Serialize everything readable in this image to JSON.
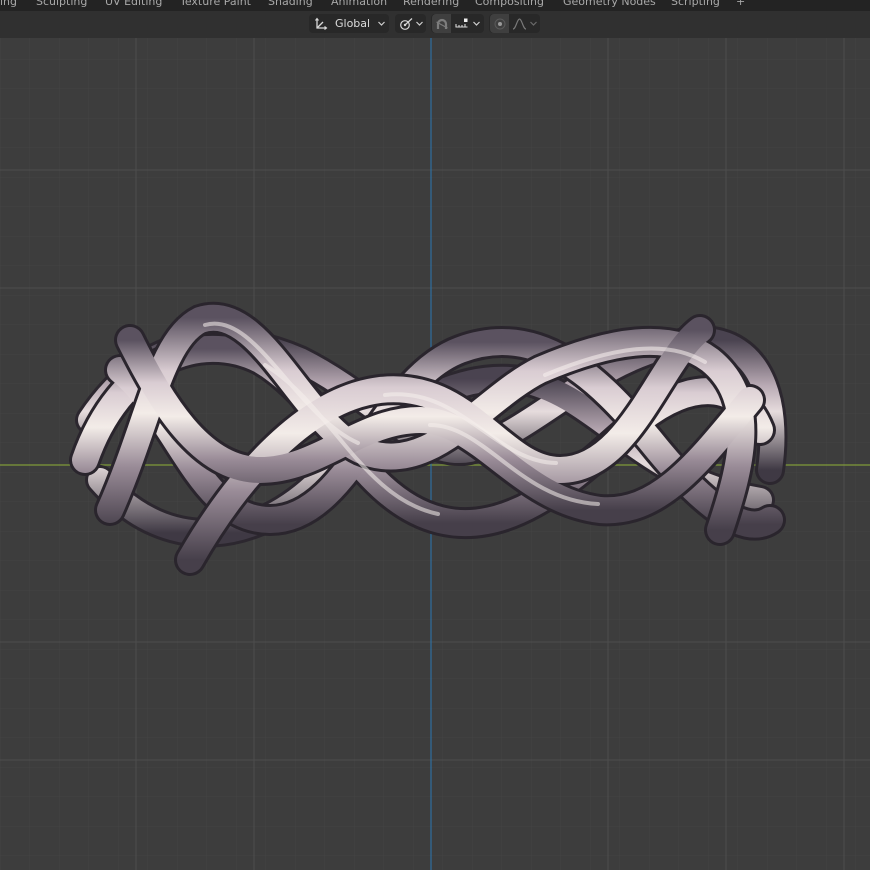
{
  "workspace_tabs": [
    {
      "label": "ing"
    },
    {
      "label": "Sculpting"
    },
    {
      "label": "UV Editing"
    },
    {
      "label": "Texture Paint"
    },
    {
      "label": "Shading"
    },
    {
      "label": "Animation"
    },
    {
      "label": "Rendering"
    },
    {
      "label": "Compositing"
    },
    {
      "label": "Geometry Nodes"
    },
    {
      "label": "Scripting"
    },
    {
      "label": "+"
    }
  ],
  "header": {
    "transform_orientation": "Global",
    "icons": {
      "orientation": "transform-orientation-icon",
      "pivot": "pivot-point-icon",
      "snap": "snap-magnet-icon",
      "snap_target": "snap-increment-icon",
      "proportional": "proportional-editing-icon",
      "falloff": "falloff-curve-icon",
      "dropdown": "chevron-down-icon"
    }
  },
  "viewport": {
    "object": "braided-ring-mesh",
    "colors": {
      "background": "#3d3d3d",
      "grid": "#4a4a4a",
      "x_axis": "#7f9a3a",
      "y_axis": "#2f6f9f",
      "metal_light": "#e8dde0",
      "metal_mid": "#9a8c96",
      "metal_dark": "#4f4650"
    }
  }
}
